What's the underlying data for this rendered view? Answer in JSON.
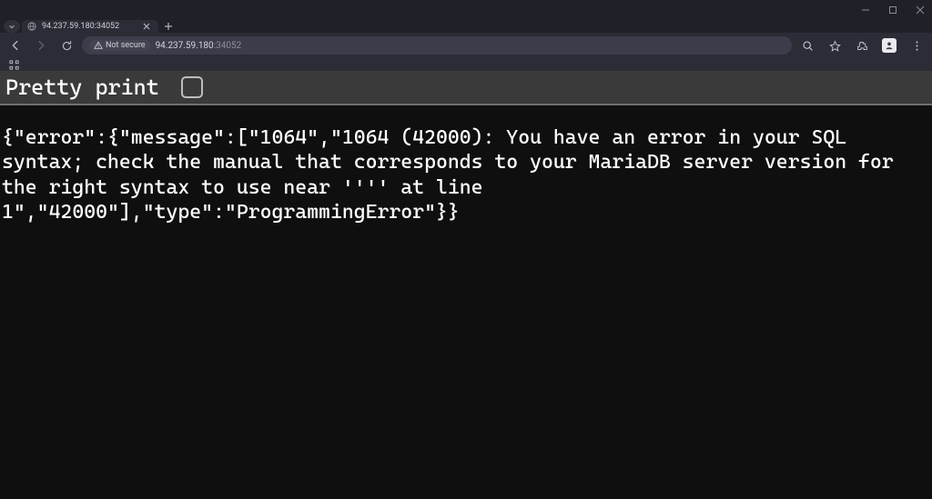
{
  "window": {
    "minimize": "—",
    "restore": "▢",
    "close": "✕"
  },
  "tab": {
    "title": "94.237.59.180:34052"
  },
  "toolbar": {
    "security_label": "Not secure",
    "url_host": "94.237.59.180",
    "url_port": ":34052"
  },
  "page": {
    "pretty_print_label": "Pretty print ",
    "json_body": "{\"error\":{\"message\":[\"1064\",\"1064 (42000): You have an error in your SQL syntax; check the manual that corresponds to your MariaDB server version for the right syntax to use near '''' at line 1\",\"42000\"],\"type\":\"ProgrammingError\"}}"
  }
}
